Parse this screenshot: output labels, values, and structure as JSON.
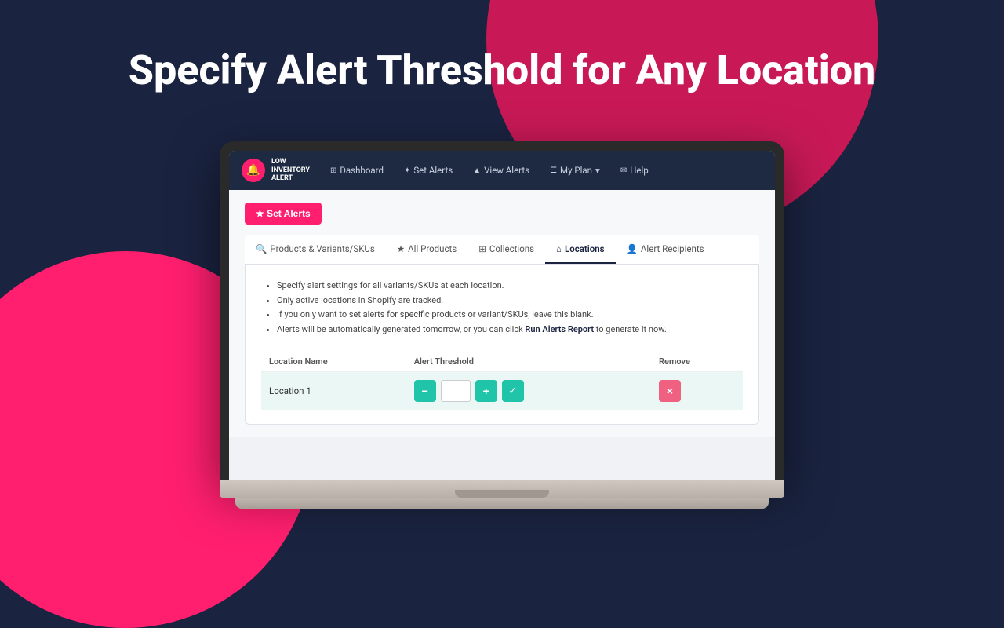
{
  "page": {
    "title": "Specify Alert Threshold for Any Location",
    "background_color": "#1a2340"
  },
  "navbar": {
    "logo_text_line1": "LOW",
    "logo_text_line2": "INVENTORY",
    "logo_text_line3": "ALERT",
    "items": [
      {
        "id": "dashboard",
        "icon": "⊞",
        "label": "Dashboard"
      },
      {
        "id": "set-alerts",
        "icon": "✦",
        "label": "Set Alerts"
      },
      {
        "id": "view-alerts",
        "icon": "▲",
        "label": "View Alerts"
      },
      {
        "id": "my-plan",
        "icon": "☰",
        "label": "My Plan",
        "has_dropdown": true
      },
      {
        "id": "help",
        "icon": "✉",
        "label": "Help"
      }
    ]
  },
  "set_alerts_button": "★  Set Alerts",
  "tabs": [
    {
      "id": "products-variants",
      "icon": "🔍",
      "label": "Products & Variants/SKUs",
      "active": false
    },
    {
      "id": "all-products",
      "icon": "★",
      "label": "All Products",
      "active": false
    },
    {
      "id": "collections",
      "icon": "⊞",
      "label": "Collections",
      "active": false
    },
    {
      "id": "locations",
      "icon": "⌂",
      "label": "Locations",
      "active": true
    },
    {
      "id": "alert-recipients",
      "icon": "👤",
      "label": "Alert Recipients",
      "active": false
    }
  ],
  "info_items": [
    "Specify alert settings for all variants/SKUs at each location.",
    "Only active locations in Shopify are tracked.",
    "If you only want to set alerts for specific products or variant/SKUs, leave this blank.",
    "Alerts will be automatically generated tomorrow, or you can click Run Alerts Report to generate it now."
  ],
  "run_link_text": "Run Alerts Report",
  "table": {
    "columns": [
      {
        "id": "location-name",
        "label": "Location Name"
      },
      {
        "id": "alert-threshold",
        "label": "Alert Threshold"
      },
      {
        "id": "remove",
        "label": "Remove"
      }
    ],
    "rows": [
      {
        "id": "location-1",
        "location_name": "Location 1",
        "threshold_value": ""
      }
    ]
  },
  "controls": {
    "minus_label": "−",
    "plus_label": "+",
    "check_label": "✓",
    "remove_label": "×"
  }
}
